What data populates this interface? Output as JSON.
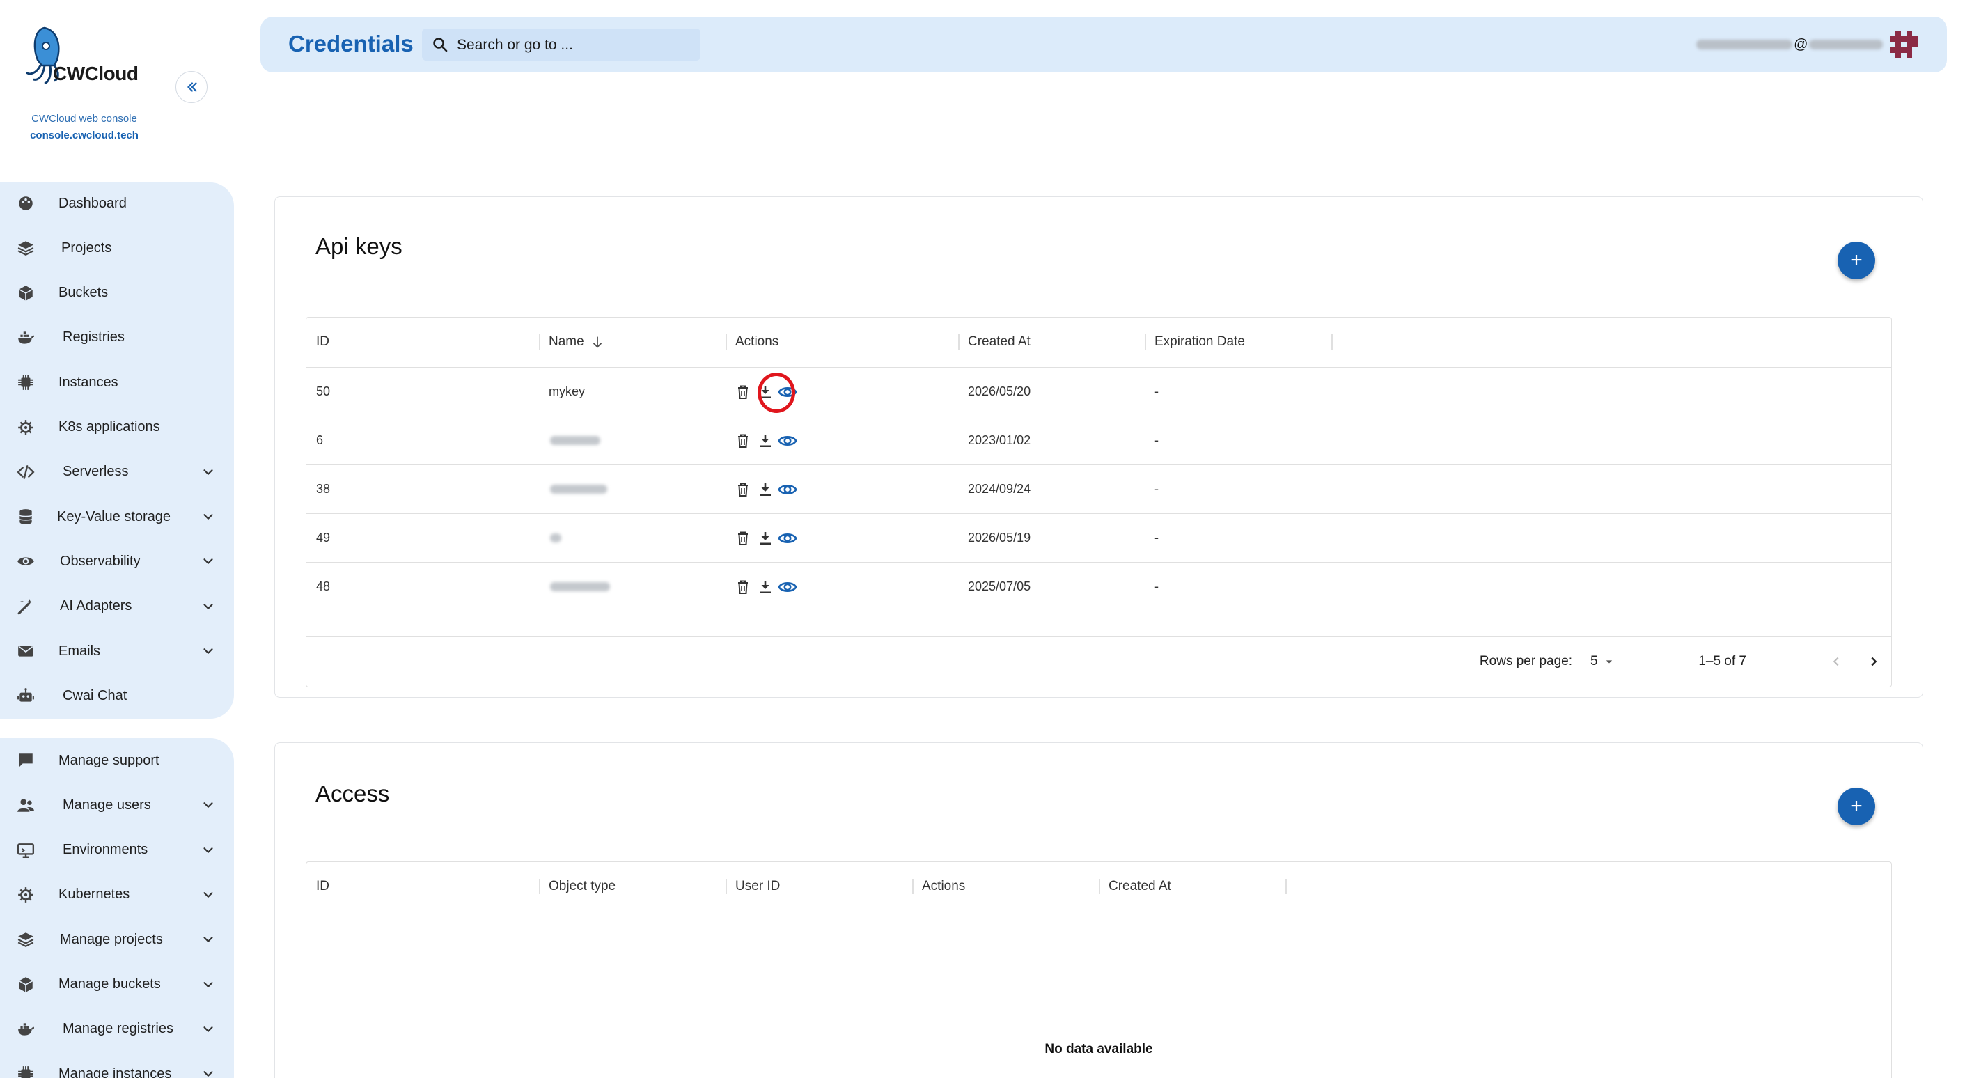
{
  "brand": {
    "logo_text": "CWCloud",
    "subtitle": "CWCloud web console",
    "url": "console.cwcloud.tech"
  },
  "header": {
    "title": "Credentials",
    "search_placeholder": "Search or go to ...",
    "user_at": "@"
  },
  "sidebar": {
    "group1": [
      {
        "label": "Dashboard",
        "icon": "palette-icon",
        "chevron": false
      },
      {
        "label": "Projects",
        "icon": "layers-icon",
        "chevron": false
      },
      {
        "label": "Buckets",
        "icon": "cube-icon",
        "chevron": false
      },
      {
        "label": "Registries",
        "icon": "docker-icon",
        "chevron": false
      },
      {
        "label": "Instances",
        "icon": "chip-icon",
        "chevron": false
      },
      {
        "label": "K8s applications",
        "icon": "helm-icon",
        "chevron": false
      },
      {
        "label": "Serverless",
        "icon": "code-icon",
        "chevron": true
      },
      {
        "label": "Key-Value storage",
        "icon": "database-icon",
        "chevron": true
      },
      {
        "label": "Observability",
        "icon": "eye-icon",
        "chevron": true
      },
      {
        "label": "AI Adapters",
        "icon": "magic-wand-icon",
        "chevron": true
      },
      {
        "label": "Emails",
        "icon": "mail-icon",
        "chevron": true
      },
      {
        "label": "Cwai Chat",
        "icon": "robot-icon",
        "chevron": false
      }
    ],
    "group2": [
      {
        "label": "Manage support",
        "icon": "chat-icon",
        "chevron": false
      },
      {
        "label": "Manage users",
        "icon": "users-icon",
        "chevron": true
      },
      {
        "label": "Environments",
        "icon": "monitor-icon",
        "chevron": true
      },
      {
        "label": "Kubernetes",
        "icon": "helm-icon",
        "chevron": true
      },
      {
        "label": "Manage projects",
        "icon": "layers-icon",
        "chevron": true
      },
      {
        "label": "Manage buckets",
        "icon": "cube-icon",
        "chevron": true
      },
      {
        "label": "Manage registries",
        "icon": "docker-icon",
        "chevron": true
      },
      {
        "label": "Manage instances",
        "icon": "chip-icon",
        "chevron": true
      }
    ]
  },
  "api_keys": {
    "title": "Api keys",
    "add_label": "+",
    "columns": [
      "ID",
      "Name",
      "Actions",
      "Created At",
      "Expiration Date"
    ],
    "rows": [
      {
        "id": "50",
        "name": "mykey",
        "created_at": "2026/05/20",
        "expiration": "-",
        "name_hidden": false
      },
      {
        "id": "6",
        "name": "",
        "created_at": "2023/01/02",
        "expiration": "-",
        "name_hidden": true
      },
      {
        "id": "38",
        "name": "",
        "created_at": "2024/09/24",
        "expiration": "-",
        "name_hidden": true
      },
      {
        "id": "49",
        "name": "",
        "created_at": "2026/05/19",
        "expiration": "-",
        "name_hidden": true
      },
      {
        "id": "48",
        "name": "",
        "created_at": "2025/07/05",
        "expiration": "-",
        "name_hidden": true
      }
    ],
    "footer": {
      "rows_per_page_label": "Rows per page:",
      "rows_per_page_value": "5",
      "range": "1–5 of 7"
    }
  },
  "access": {
    "title": "Access",
    "add_label": "+",
    "columns": [
      "ID",
      "Object type",
      "User ID",
      "Actions",
      "Created At"
    ],
    "empty_text": "No data available"
  },
  "colors": {
    "primary": "#1862b2",
    "sidebar_bg": "#e3eefa",
    "header_bg": "#dcebfa",
    "highlight": "#e0161d"
  }
}
